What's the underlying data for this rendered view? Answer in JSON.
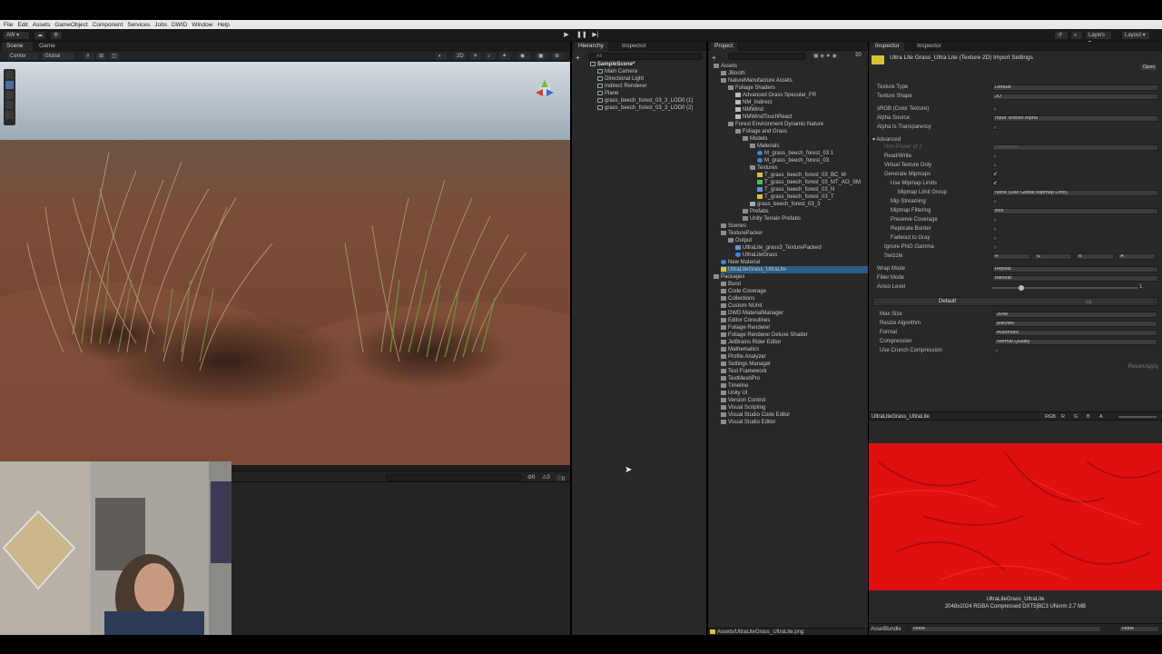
{
  "menu": [
    "File",
    "Edit",
    "Assets",
    "GameObject",
    "Component",
    "Services",
    "Jobs",
    "DWID",
    "Window",
    "Help"
  ],
  "toolbar": {
    "account": "AW",
    "layers": "Layers",
    "layout": "Layout"
  },
  "scene_tabs": [
    {
      "label": "Scene"
    },
    {
      "label": "Game"
    }
  ],
  "scene_toolbar": {
    "pivot": "Center",
    "space": "Global",
    "mode2d": "2D"
  },
  "console": {
    "errors": "0",
    "warnings": "0",
    "messages": "0"
  },
  "hierarchy": {
    "tab_label": "Hierarchy",
    "inspector_tab": "Inspector",
    "search_placeholder": "All",
    "scene_name": "SampleScene*",
    "items": [
      "Main Camera",
      "Directional Light",
      "Indirect Renderer",
      "Plane",
      "grass_beech_forest_03_3_LOD0 (1)",
      "grass_beech_forest_03_3_LOD0 (2)"
    ]
  },
  "project": {
    "tab_label": "Project",
    "count": "20",
    "tree": [
      {
        "label": "Assets",
        "depth": 0,
        "type": "folder"
      },
      {
        "label": "JBooth",
        "depth": 1,
        "type": "folder"
      },
      {
        "label": "NatureManufacture Assets",
        "depth": 1,
        "type": "folder"
      },
      {
        "label": "Foliage Shaders",
        "depth": 2,
        "type": "folder"
      },
      {
        "label": "Advanced Grass Specular_FR",
        "depth": 3,
        "type": "file"
      },
      {
        "label": "NM_Indirect",
        "depth": 3,
        "type": "file"
      },
      {
        "label": "NMWind",
        "depth": 3,
        "type": "file"
      },
      {
        "label": "NMWindTouchReact",
        "depth": 3,
        "type": "file"
      },
      {
        "label": "Forest Environment Dynamic Nature",
        "depth": 2,
        "type": "folder"
      },
      {
        "label": "Foliage and Grass",
        "depth": 3,
        "type": "folder"
      },
      {
        "label": "Models",
        "depth": 4,
        "type": "folder"
      },
      {
        "label": "Materials",
        "depth": 5,
        "type": "folder"
      },
      {
        "label": "M_grass_beech_forest_03 1",
        "depth": 6,
        "type": "mat"
      },
      {
        "label": "M_grass_beech_forest_03",
        "depth": 6,
        "type": "mat"
      },
      {
        "label": "Textures",
        "depth": 5,
        "type": "folder"
      },
      {
        "label": "T_grass_beech_forest_03_BC_M",
        "depth": 6,
        "type": "tex"
      },
      {
        "label": "T_grass_beech_forest_03_MT_AO_SM",
        "depth": 6,
        "type": "tex2"
      },
      {
        "label": "T_grass_beech_forest_03_N",
        "depth": 6,
        "type": "tex3"
      },
      {
        "label": "T_grass_beech_forest_03_T",
        "depth": 6,
        "type": "tex"
      },
      {
        "label": "grass_beech_forest_03_3",
        "depth": 5,
        "type": "mesh"
      },
      {
        "label": "Prefabs",
        "depth": 4,
        "type": "folder"
      },
      {
        "label": "Unity Terrain Prefabs",
        "depth": 4,
        "type": "folder"
      },
      {
        "label": "Scenes",
        "depth": 1,
        "type": "folder"
      },
      {
        "label": "TexturePacker",
        "depth": 1,
        "type": "folder"
      },
      {
        "label": "Output",
        "depth": 2,
        "type": "folder"
      },
      {
        "label": "UltraLite_grass3_TexturePacked",
        "depth": 3,
        "type": "tex3"
      },
      {
        "label": "UltraLiteGrass",
        "depth": 3,
        "type": "mat"
      },
      {
        "label": "New Material",
        "depth": 1,
        "type": "mat"
      },
      {
        "label": "UltraLiteGrass_UltraLite",
        "depth": 1,
        "type": "tex",
        "selected": true
      },
      {
        "label": "Packages",
        "depth": 0,
        "type": "folder"
      },
      {
        "label": "Burst",
        "depth": 1,
        "type": "folder"
      },
      {
        "label": "Code Coverage",
        "depth": 1,
        "type": "folder"
      },
      {
        "label": "Collections",
        "depth": 1,
        "type": "folder"
      },
      {
        "label": "Custom NUnit",
        "depth": 1,
        "type": "folder"
      },
      {
        "label": "DWD MaterialManager",
        "depth": 1,
        "type": "folder"
      },
      {
        "label": "Editor Coroutines",
        "depth": 1,
        "type": "folder"
      },
      {
        "label": "Foliage Renderer",
        "depth": 1,
        "type": "folder"
      },
      {
        "label": "Foliage Renderer Deluxe Shader",
        "depth": 1,
        "type": "folder"
      },
      {
        "label": "JetBrains Rider Editor",
        "depth": 1,
        "type": "folder"
      },
      {
        "label": "Mathematics",
        "depth": 1,
        "type": "folder"
      },
      {
        "label": "Profile Analyzer",
        "depth": 1,
        "type": "folder"
      },
      {
        "label": "Settings Manager",
        "depth": 1,
        "type": "folder"
      },
      {
        "label": "Test Framework",
        "depth": 1,
        "type": "folder"
      },
      {
        "label": "TextMeshPro",
        "depth": 1,
        "type": "folder"
      },
      {
        "label": "Timeline",
        "depth": 1,
        "type": "folder"
      },
      {
        "label": "Unity UI",
        "depth": 1,
        "type": "folder"
      },
      {
        "label": "Version Control",
        "depth": 1,
        "type": "folder"
      },
      {
        "label": "Visual Scripting",
        "depth": 1,
        "type": "folder"
      },
      {
        "label": "Visual Studio Code Editor",
        "depth": 1,
        "type": "folder"
      },
      {
        "label": "Visual Studio Editor",
        "depth": 1,
        "type": "folder"
      }
    ],
    "footer_path": "Assets/UltraLiteGrass_UltraLite.png"
  },
  "inspector": {
    "tab1": "Inspector",
    "tab2": "Inspector",
    "title": "Ultra Lite Grass_Ultra Lite (Texture 2D) Import Settings",
    "open_label": "Open",
    "fields": [
      {
        "label": "Texture Type",
        "value": "Default"
      },
      {
        "label": "Texture Shape",
        "value": "2D"
      },
      {
        "label": "sRGB (Color Texture)",
        "check": ""
      },
      {
        "label": "Alpha Source",
        "value": "Input Texture Alpha"
      },
      {
        "label": "Alpha Is Transparency",
        "check": ""
      }
    ],
    "advanced_label": "Advanced",
    "adv_fields": [
      {
        "label": "Non-Power of 2",
        "value": "ToNearest",
        "dim": true
      },
      {
        "label": "Read/Write",
        "check": ""
      },
      {
        "label": "Virtual Texture Only",
        "check": ""
      },
      {
        "label": "Generate Mipmaps",
        "check": "✓"
      },
      {
        "label": "Use Mipmap Limits",
        "check": "✓",
        "indent": true
      },
      {
        "label": "Mipmap Limit Group",
        "value": "None (Use Global Mipmap Limit)",
        "indent2": true
      },
      {
        "label": "Mip Streaming",
        "check": "",
        "indent": true
      },
      {
        "label": "Mipmap Filtering",
        "value": "Box",
        "indent": true
      },
      {
        "label": "Preserve Coverage",
        "check": "",
        "indent": true
      },
      {
        "label": "Replicate Border",
        "check": "",
        "indent": true
      },
      {
        "label": "Fadeout to Gray",
        "check": "",
        "indent": true
      },
      {
        "label": "Ignore PNG Gamma",
        "check": ""
      }
    ],
    "swizzle": {
      "label": "Swizzle",
      "values": [
        "R",
        "G",
        "B",
        "A"
      ]
    },
    "wrap_mode": {
      "label": "Wrap Mode",
      "value": "Repeat"
    },
    "filter_mode": {
      "label": "Filter Mode",
      "value": "Bilinear"
    },
    "aniso": {
      "label": "Aniso Level",
      "value": "1",
      "fraction": 0.2
    },
    "platform": {
      "default_tab": "Default"
    },
    "platform_fields": [
      {
        "label": "Max Size",
        "value": "2048"
      },
      {
        "label": "Resize Algorithm",
        "value": "Mitchell"
      },
      {
        "label": "Format",
        "value": "Automatic"
      },
      {
        "label": "Compression",
        "value": "Normal Quality"
      },
      {
        "label": "Use Crunch Compression",
        "check": ""
      }
    ],
    "revert_label": "Revert",
    "apply_label": "Apply",
    "preview": {
      "name": "UltraLiteGrass_UltraLite",
      "channel": "RGB",
      "channels": [
        "R",
        "G",
        "B",
        "A"
      ],
      "caption_name": "UltraLiteGrass_UltraLite",
      "caption_info": "2048x1024  RGBA Compressed DXT5|BC3 UNorm  2.7 MB"
    },
    "asset_bundle": {
      "label": "AssetBundle",
      "value": "None",
      "variant": "None"
    }
  },
  "colors": {
    "accent": "#2c5d87",
    "preview_red": "#e01010",
    "ground": "#7a4a36",
    "sky": "#a9b8c6"
  }
}
